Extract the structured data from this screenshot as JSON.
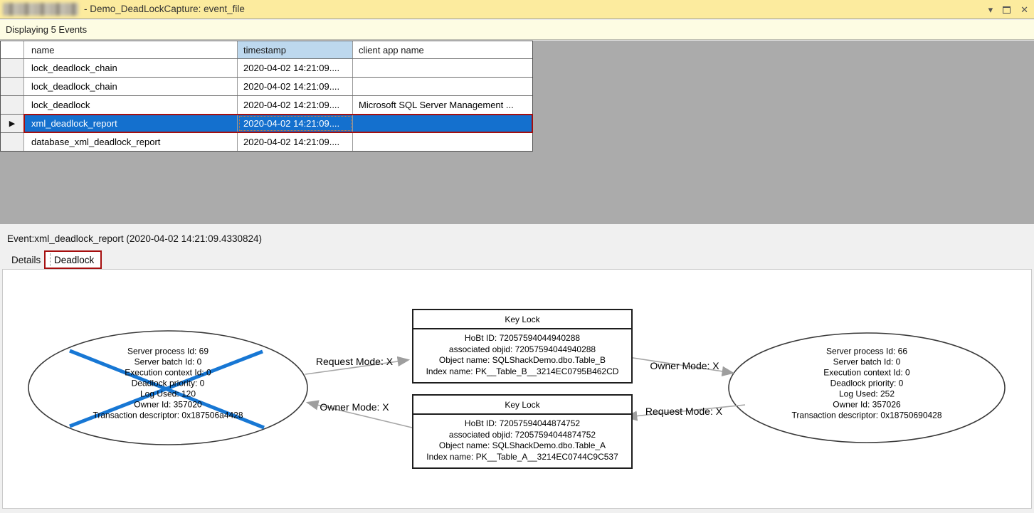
{
  "window": {
    "title": "- Demo_DeadLockCapture: event_file",
    "icons": {
      "dropdown": "▾",
      "close": "✕"
    }
  },
  "status_bar": {
    "text": "Displaying 5 Events"
  },
  "events_table": {
    "selected_row_indicator": "▶",
    "columns": {
      "name": "name",
      "timestamp": "timestamp",
      "client_app_name": "client  app  name"
    },
    "rows": [
      {
        "name": "lock_deadlock_chain",
        "timestamp": "2020-04-02 14:21:09....",
        "client_app_name": ""
      },
      {
        "name": "lock_deadlock_chain",
        "timestamp": "2020-04-02 14:21:09....",
        "client_app_name": ""
      },
      {
        "name": "lock_deadlock",
        "timestamp": "2020-04-02 14:21:09....",
        "client_app_name": "Microsoft SQL Server Management ..."
      },
      {
        "name": "xml_deadlock_report",
        "timestamp": "2020-04-02 14:21:09....",
        "client_app_name": "",
        "selected": true
      },
      {
        "name": "database_xml_deadlock_report",
        "timestamp": "2020-04-02 14:21:09....",
        "client_app_name": ""
      }
    ]
  },
  "event_detail": {
    "header": "Event:xml_deadlock_report (2020-04-02 14:21:09.4330824)",
    "tabs": {
      "details": "Details",
      "deadlock": "Deadlock"
    }
  },
  "deadlock_graph": {
    "process_left": {
      "victim": true,
      "lines": [
        "Server process Id: 69",
        "Server batch Id: 0",
        "Execution context Id: 0",
        "Deadlock priority: 0",
        "Log Used: 120",
        "Owner Id: 357020",
        "Transaction descriptor: 0x187506a4428"
      ]
    },
    "process_right": {
      "victim": false,
      "lines": [
        "Server process Id: 66",
        "Server batch Id: 0",
        "Execution context Id: 0",
        "Deadlock priority: 0",
        "Log Used: 252",
        "Owner Id: 357026",
        "Transaction descriptor: 0x18750690428"
      ]
    },
    "resource_top": {
      "title": "Key Lock",
      "lines": [
        "HoBt ID: 72057594044940288",
        "associated objid: 72057594044940288",
        "Object name: SQLShackDemo.dbo.Table_B",
        "Index name: PK__Table_B__3214EC0795B462CD"
      ]
    },
    "resource_bottom": {
      "title": "Key Lock",
      "lines": [
        "HoBt ID: 72057594044874752",
        "associated objid: 72057594044874752",
        "Object name: SQLShackDemo.dbo.Table_A",
        "Index name: PK__Table_A__3214EC0744C9C537"
      ]
    },
    "edge_labels": {
      "top_left": "Request Mode: X",
      "top_right": "Owner Mode: X",
      "bottom_left": "Owner Mode: X",
      "bottom_right": "Request Mode: X"
    }
  },
  "colors": {
    "titlebar_yellow": "#FCEB9E",
    "statusbar_yellow": "#FDFCE3",
    "workspace_gray": "#ABABAB",
    "selection_blue": "#1470CE",
    "selection_border_red": "#A50F0F",
    "timestamp_header_blue": "#BDD8EE",
    "victim_x_blue": "#1777D4",
    "arrow_gray": "#A6A6A6"
  }
}
